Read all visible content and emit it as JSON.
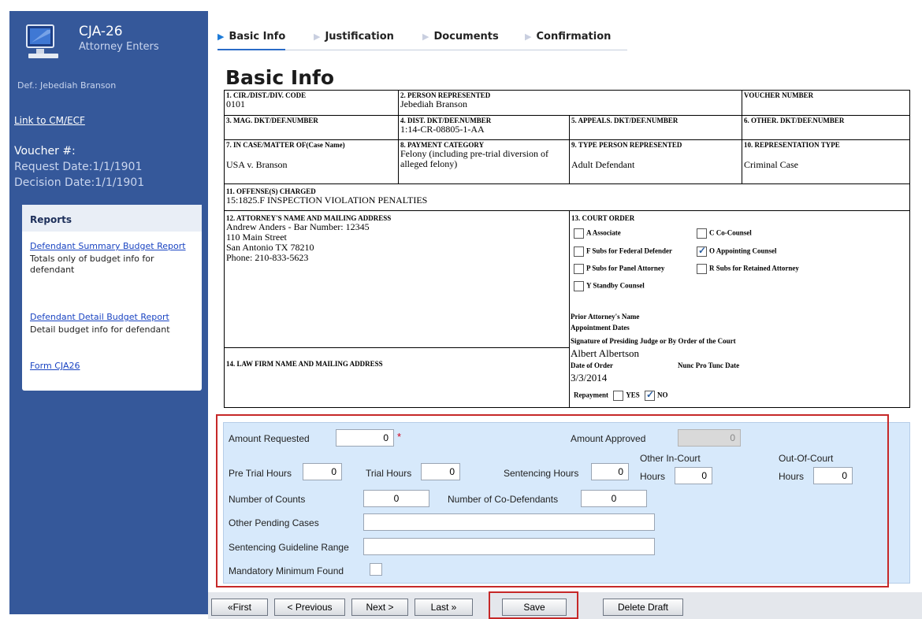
{
  "sidebar": {
    "title": "CJA-26",
    "subtitle": "Attorney Enters",
    "defendant": "Def.: Jebediah Branson",
    "link_cmecf": "Link to CM/ECF",
    "voucher": "Voucher #:",
    "request_date": "Request Date:1/1/1901",
    "decision_date": "Decision Date:1/1/1901",
    "reports": {
      "title": "Reports",
      "items": [
        {
          "link": "Defendant Summary Budget Report",
          "desc": "Totals only of budget info for defendant"
        },
        {
          "link": "Defendant Detail Budget Report",
          "desc": "Detail budget info for defendant"
        },
        {
          "link": "Form CJA26",
          "desc": ""
        }
      ]
    }
  },
  "tabs": [
    "Basic Info",
    "Justification",
    "Documents",
    "Confirmation"
  ],
  "page_title": "Basic Info",
  "form": {
    "f1_label": "1. CIR./DIST./DIV. CODE",
    "f1_value": "0101",
    "f2_label": "2. PERSON REPRESENTED",
    "f2_value": "Jebediah Branson",
    "f_voucher_label": "VOUCHER NUMBER",
    "f3_label": "3. MAG. DKT/DEF.NUMBER",
    "f4_label": "4. DIST. DKT/DEF.NUMBER",
    "f4_value": "1:14-CR-08805-1-AA",
    "f5_label": "5. APPEALS. DKT/DEF.NUMBER",
    "f6_label": "6. OTHER. DKT/DEF.NUMBER",
    "f7_label": "7. IN CASE/MATTER OF(Case Name)",
    "f7_value": "USA v. Branson",
    "f8_label": "8. PAYMENT CATEGORY",
    "f8_value": "Felony (including pre-trial diversion of alleged felony)",
    "f9_label": "9. TYPE PERSON REPRESENTED",
    "f9_value": "Adult Defendant",
    "f10_label": "10. REPRESENTATION TYPE",
    "f10_value": "Criminal Case",
    "f11_label": "11. OFFENSE(S) CHARGED",
    "f11_value": "15:1825.F INSPECTION VIOLATION PENALTIES",
    "f12_label": "12. ATTORNEY'S NAME AND MAILING ADDRESS",
    "f12_lines": [
      "Andrew Anders - Bar Number: 12345",
      "110 Main Street",
      "San Antonio TX 78210",
      "Phone: 210-833-5623"
    ],
    "f13_label": "13. COURT ORDER",
    "court_order": {
      "a_associate": "A Associate",
      "c_cocounsel": "C Co-Counsel",
      "f_subs_federal": "F Subs for Federal Defender",
      "o_appointing": "O Appointing Counsel",
      "p_subs_panel": "P Subs for Panel Attorney",
      "r_subs_retained": "R Subs for Retained Attorney",
      "y_standby": "Y Standby Counsel",
      "prior_attorney": "Prior Attorney's Name",
      "appointment_dates": "Appointment Dates",
      "signature_label": "Signature of Presiding Judge or By Order of the Court",
      "judge_name": "Albert Albertson",
      "date_of_order_label": "Date of Order",
      "nunc_pro_tunc": "Nunc Pro Tunc Date",
      "date_of_order": "3/3/2014",
      "repayment_label": "Repayment",
      "yes": "YES",
      "no": "NO"
    },
    "f14_label": "14. LAW FIRM NAME AND MAILING ADDRESS"
  },
  "entry": {
    "amount_requested_label": "Amount Requested",
    "amount_requested": "0",
    "required_mark": "*",
    "amount_approved_label": "Amount Approved",
    "amount_approved": "0",
    "pretrial_label": "Pre Trial Hours",
    "pretrial": "0",
    "trial_label": "Trial Hours",
    "trial": "0",
    "sentencing_label": "Sentencing Hours",
    "sentencing": "0",
    "other_in_court_label_1": "Other In-Court",
    "other_in_court_label_2": "Hours",
    "other_in_court": "0",
    "out_of_court_label_1": "Out-Of-Court",
    "out_of_court_label_2": "Hours",
    "out_of_court": "0",
    "counts_label": "Number of Counts",
    "counts": "0",
    "codefendants_label": "Number of Co-Defendants",
    "codefendants": "0",
    "pending_label": "Other Pending Cases",
    "pending": "",
    "guideline_label": "Sentencing Guideline Range",
    "guideline": "",
    "mandatory_label": "Mandatory Minimum Found"
  },
  "buttons": {
    "first": "«First",
    "previous": "< Previous",
    "next": "Next >",
    "last": "Last »",
    "save": "Save",
    "delete_draft": "Delete Draft"
  },
  "colors": {
    "sidebar": "#35589a",
    "panel": "#d7e9fb",
    "highlight": "#c62828",
    "link": "#1a44c2"
  }
}
